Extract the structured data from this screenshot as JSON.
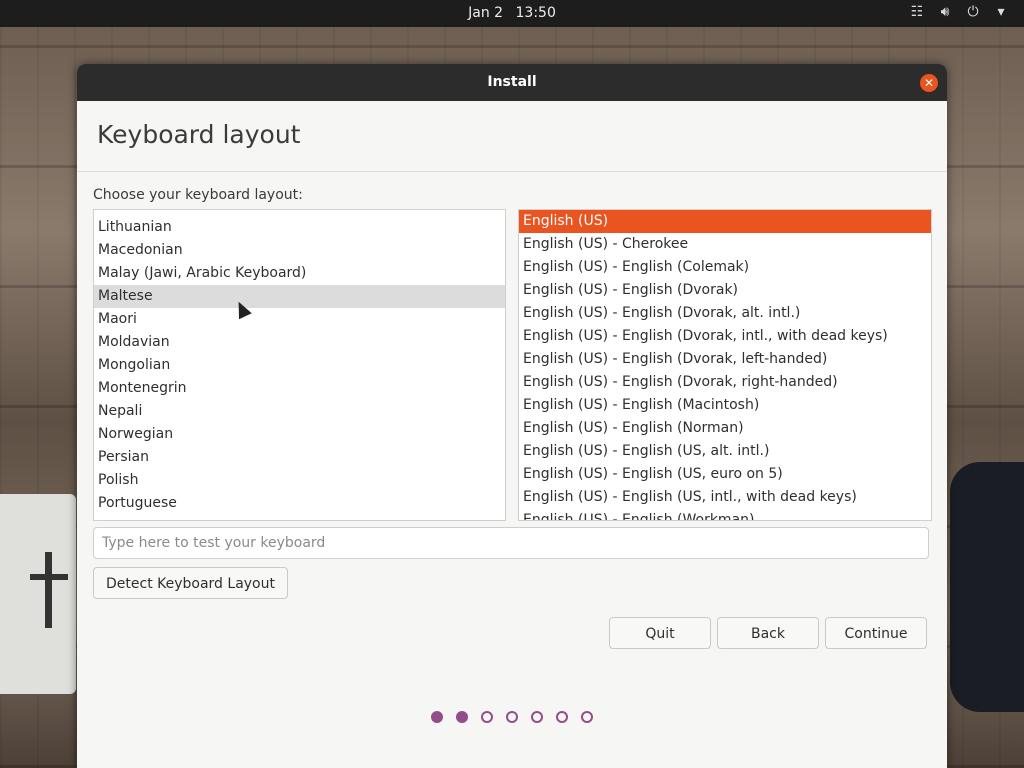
{
  "topbar": {
    "date": "Jan 2",
    "time": "13:50",
    "tray_icons": [
      "network-icon",
      "volume-icon",
      "power-icon",
      "chevron-down-icon"
    ]
  },
  "window": {
    "title": "Install",
    "heading": "Keyboard layout",
    "prompt": "Choose your keyboard layout:"
  },
  "layouts": {
    "items": [
      "Lithuanian",
      "Macedonian",
      "Malay (Jawi, Arabic Keyboard)",
      "Maltese",
      "Maori",
      "Moldavian",
      "Mongolian",
      "Montenegrin",
      "Nepali",
      "Norwegian",
      "Persian",
      "Polish",
      "Portuguese"
    ],
    "hovered": "Maltese"
  },
  "variants": {
    "items": [
      "English (US)",
      "English (US) - Cherokee",
      "English (US) - English (Colemak)",
      "English (US) - English (Dvorak)",
      "English (US) - English (Dvorak, alt. intl.)",
      "English (US) - English (Dvorak, intl., with dead keys)",
      "English (US) - English (Dvorak, left-handed)",
      "English (US) - English (Dvorak, right-handed)",
      "English (US) - English (Macintosh)",
      "English (US) - English (Norman)",
      "English (US) - English (US, alt. intl.)",
      "English (US) - English (US, euro on 5)",
      "English (US) - English (US, intl., with dead keys)",
      "English (US) - English (Workman)"
    ],
    "selected": "English (US)"
  },
  "test_input": {
    "placeholder": "Type here to test your keyboard",
    "value": ""
  },
  "buttons": {
    "detect": "Detect Keyboard Layout",
    "quit": "Quit",
    "back": "Back",
    "continue": "Continue"
  },
  "progress": {
    "total_steps": 7,
    "completed_steps": 2
  },
  "colors": {
    "accent": "#e95420",
    "progress_dot": "#924d8b"
  }
}
